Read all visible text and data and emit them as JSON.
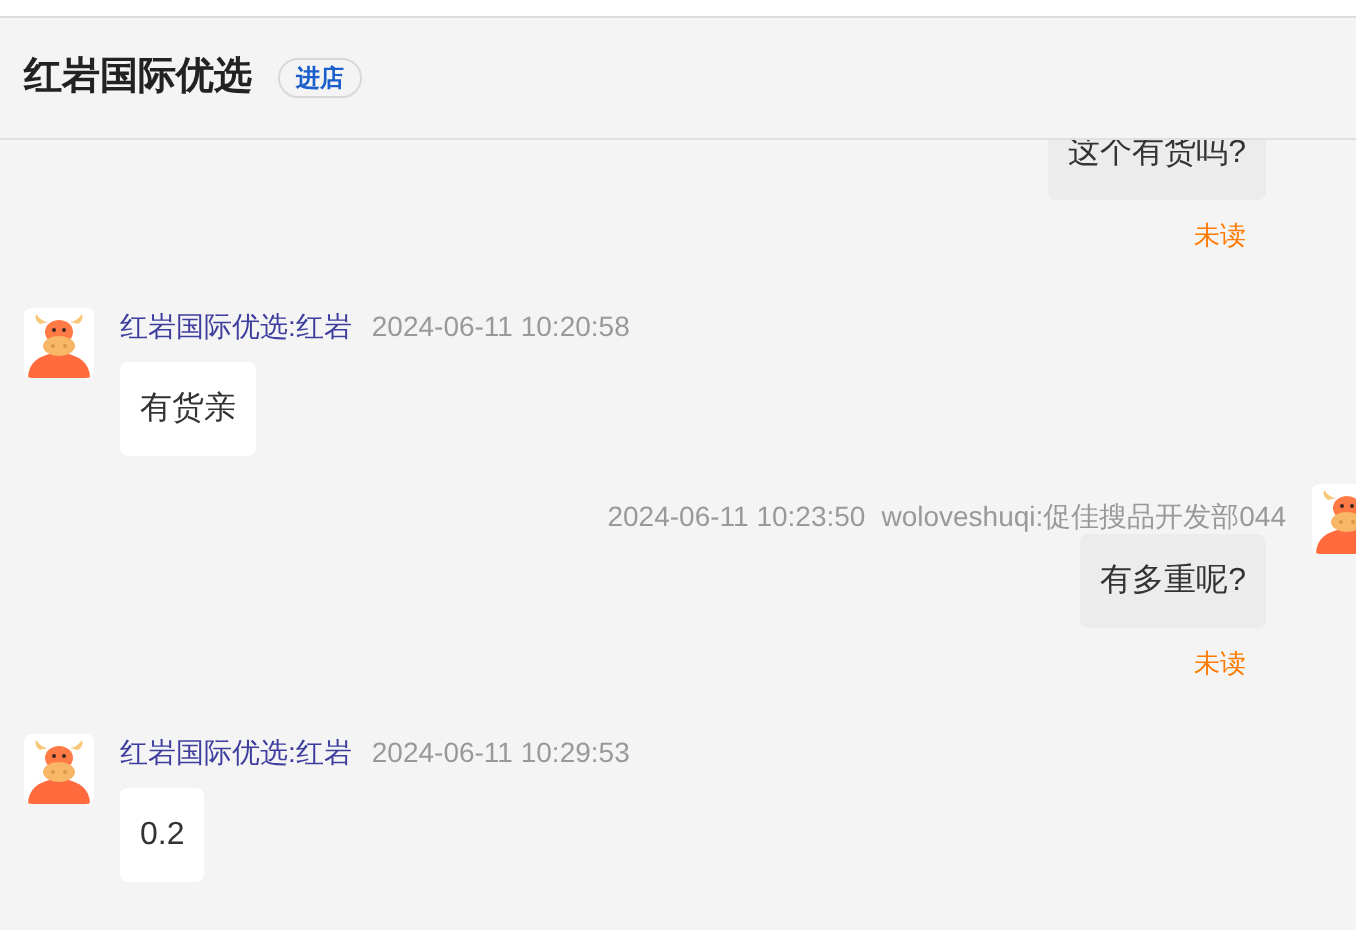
{
  "header": {
    "title": "红岩国际优选",
    "store_button": "进店"
  },
  "messages": [
    {
      "kind": "sent",
      "text": "这个有货吗?",
      "status": "未读"
    },
    {
      "kind": "received",
      "sender": "红岩国际优选:红岩",
      "time": "2024-06-11 10:20:58",
      "text": "有货亲"
    },
    {
      "kind": "sent",
      "time": "2024-06-11 10:23:50",
      "sender": "woloveshuqi:促佳搜品开发部044",
      "text": "有多重呢?",
      "status": "未读"
    },
    {
      "kind": "received",
      "sender": "红岩国际优选:红岩",
      "time": "2024-06-11 10:29:53",
      "text": "0.2"
    }
  ]
}
